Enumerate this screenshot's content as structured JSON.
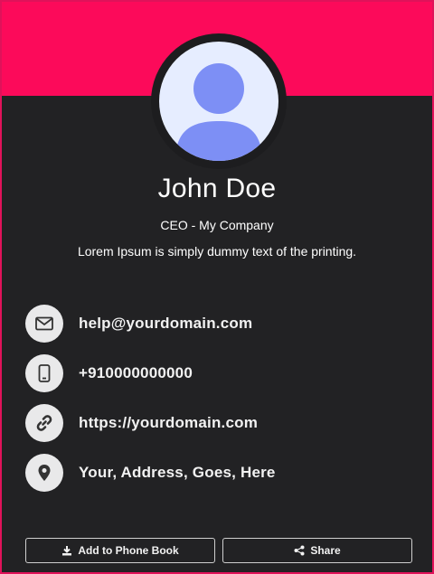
{
  "profile": {
    "name": "John Doe",
    "title": "CEO - My Company",
    "description": "Lorem Ipsum is simply dummy text of the printing."
  },
  "contacts": [
    {
      "icon": "envelope-icon",
      "value": "help@yourdomain.com"
    },
    {
      "icon": "mobile-phone-icon",
      "value": "+910000000000"
    },
    {
      "icon": "link-icon",
      "value": "https://yourdomain.com"
    },
    {
      "icon": "map-marker-icon",
      "value": "Your, Address, Goes, Here"
    }
  ],
  "actions": {
    "add_label": "Add to Phone Book",
    "share_label": "Share"
  },
  "colors": {
    "accent": "#fc0a5a",
    "card_background": "#222224",
    "avatar_bg": "#e6edff",
    "avatar_figure": "#7d8ff5"
  }
}
